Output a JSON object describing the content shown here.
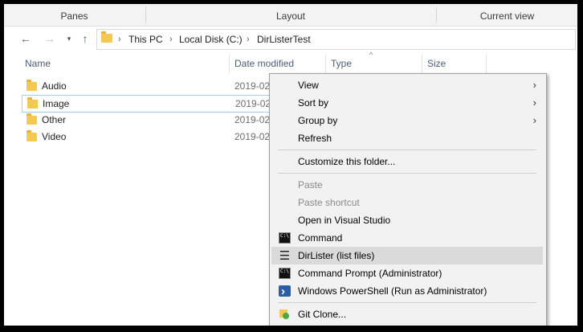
{
  "ribbon": {
    "groups": [
      "Panes",
      "Layout",
      "Current view"
    ]
  },
  "nav": {
    "back_icon": "arrow-left-icon",
    "forward_icon": "arrow-right-icon",
    "recent_icon": "chevron-down-icon",
    "up_icon": "arrow-up-icon"
  },
  "address": {
    "crumbs": [
      "This PC",
      "Local Disk (C:)",
      "DirListerTest"
    ],
    "separator": "›"
  },
  "columns": {
    "name": "Name",
    "date_modified": "Date modified",
    "type": "Type",
    "size": "Size",
    "sort_indicator": "^"
  },
  "files": [
    {
      "name": "Audio",
      "date": "2019-02-"
    },
    {
      "name": "Image",
      "date": "2019-02-"
    },
    {
      "name": "Other",
      "date": "2019-02-"
    },
    {
      "name": "Video",
      "date": "2019-02-"
    }
  ],
  "context_menu": {
    "submenu_arrow": "›",
    "items": {
      "view": "View",
      "sort_by": "Sort by",
      "group_by": "Group by",
      "refresh": "Refresh",
      "customize": "Customize this folder...",
      "paste": "Paste",
      "paste_shortcut": "Paste shortcut",
      "open_vs": "Open in Visual Studio",
      "command": "Command",
      "dirlister": "DirLister (list files)",
      "cmd_admin": "Command Prompt (Administrator)",
      "powershell_admin": "Windows PowerShell (Run as Administrator)",
      "git_clone": "Git Clone..."
    }
  },
  "colors": {
    "selection_border": "#99d1ff",
    "menu_hover": "#dadada",
    "folder": "#f3c94f"
  }
}
